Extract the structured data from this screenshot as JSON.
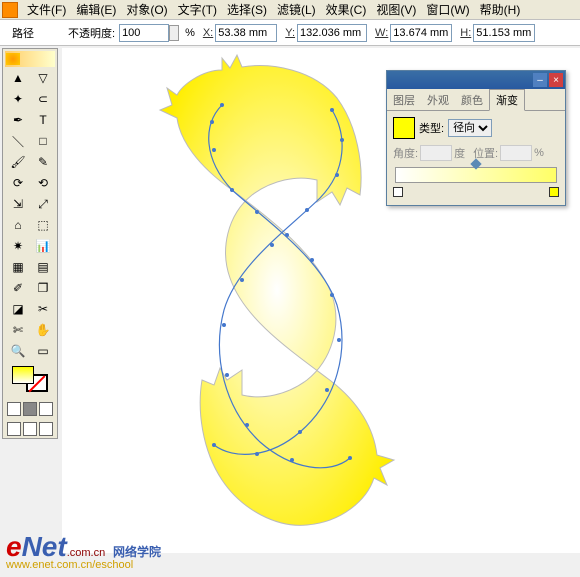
{
  "menu": {
    "items": [
      "文件(F)",
      "编辑(E)",
      "对象(O)",
      "文字(T)",
      "选择(S)",
      "滤镜(L)",
      "效果(C)",
      "视图(V)",
      "窗口(W)",
      "帮助(H)"
    ]
  },
  "options": {
    "tool_name": "路径",
    "opacity_label": "不透明度:",
    "opacity_value": "100",
    "opacity_unit": "%",
    "x_label": "X:",
    "x_value": "53.38 mm",
    "y_label": "Y:",
    "y_value": "132.036 mm",
    "w_label": "W:",
    "w_value": "13.674 mm",
    "h_label": "H:",
    "h_value": "51.153 mm"
  },
  "tools": {
    "names": [
      "selection-tool",
      "direct-selection-tool",
      "magic-wand-tool",
      "lasso-tool",
      "pen-tool",
      "type-tool",
      "line-tool",
      "rectangle-tool",
      "paintbrush-tool",
      "pencil-tool",
      "rotate-tool",
      "reflect-tool",
      "scale-tool",
      "shear-tool",
      "warp-tool",
      "free-transform-tool",
      "symbol-sprayer-tool",
      "graph-tool",
      "mesh-tool",
      "gradient-tool",
      "eyedropper-tool",
      "blend-tool",
      "live-paint-tool",
      "slice-tool",
      "scissors-tool",
      "hand-tool",
      "zoom-tool",
      "page-tool"
    ],
    "glyphs": [
      "▲",
      "▽",
      "✦",
      "⊂",
      "✒",
      "T",
      "＼",
      "□",
      "🖌",
      "✎",
      "⟳",
      "⟲",
      "⇲",
      "⤢",
      "⌂",
      "⬚",
      "✷",
      "📊",
      "▦",
      "▤",
      "✐",
      "❐",
      "◪",
      "✂",
      "✄",
      "✋",
      "🔍",
      "▭"
    ]
  },
  "panel": {
    "tabs": [
      "图层",
      "外观",
      "颜色",
      "渐变"
    ],
    "active_tab": 3,
    "type_label": "类型:",
    "type_value": "径向",
    "angle_label": "角度:",
    "angle_unit": "度",
    "position_label": "位置:",
    "position_unit": "%"
  },
  "watermark": {
    "brand_e": "e",
    "brand_net": "Net",
    "domain": ".com.cn",
    "academy": "网络学院",
    "url": "www.enet.com.cn/eschool"
  }
}
